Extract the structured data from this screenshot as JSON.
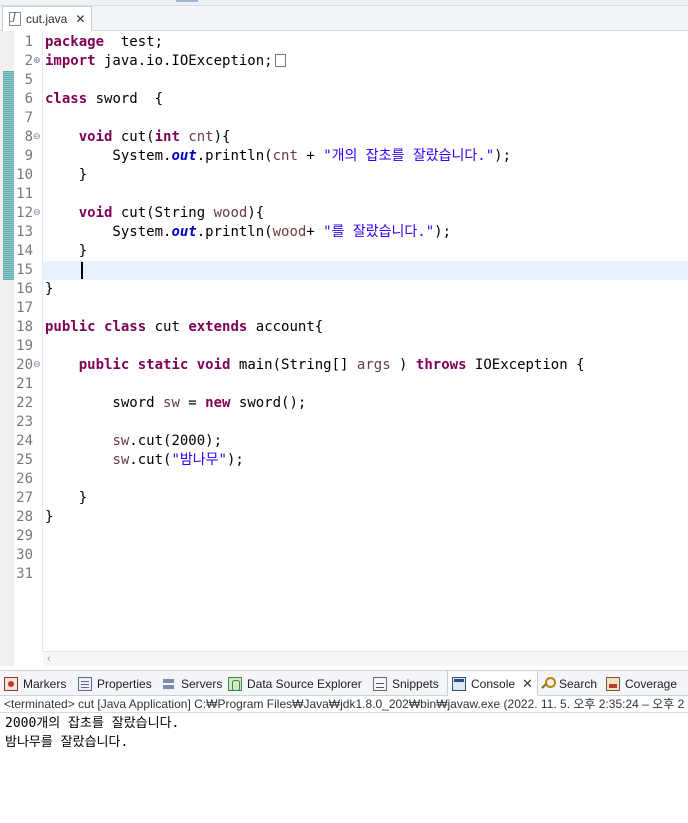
{
  "editor_tab": {
    "label": "cut.java",
    "close": "✕"
  },
  "code": [
    {
      "n": "1",
      "tokens": [
        [
          "kw",
          "package"
        ],
        [
          "",
          "  test;"
        ]
      ]
    },
    {
      "n": "2",
      "tokens": [
        [
          "kw",
          "import"
        ],
        [
          "",
          " java.io.IOException;"
        ]
      ],
      "fold": "⊕",
      "box": true
    },
    {
      "n": "5",
      "tokens": []
    },
    {
      "n": "6",
      "tokens": [
        [
          "kw",
          "class"
        ],
        [
          "",
          " sword  {"
        ]
      ]
    },
    {
      "n": "7",
      "tokens": []
    },
    {
      "n": "8",
      "tokens": [
        [
          "",
          "    "
        ],
        [
          "kw",
          "void"
        ],
        [
          "",
          " cut("
        ],
        [
          "kw",
          "int"
        ],
        [
          "",
          " "
        ],
        [
          "var",
          "cnt"
        ],
        [
          "",
          "){"
        ]
      ],
      "fold": "⊖"
    },
    {
      "n": "9",
      "tokens": [
        [
          "",
          "        System."
        ],
        [
          "fld",
          "out"
        ],
        [
          "",
          ".println("
        ],
        [
          "var",
          "cnt"
        ],
        [
          "",
          " + "
        ],
        [
          "str",
          "\"개의 잡초를 잘랐습니다.\""
        ],
        [
          "",
          ");"
        ]
      ]
    },
    {
      "n": "10",
      "tokens": [
        [
          "",
          "    }"
        ]
      ]
    },
    {
      "n": "11",
      "tokens": []
    },
    {
      "n": "12",
      "tokens": [
        [
          "",
          "    "
        ],
        [
          "kw",
          "void"
        ],
        [
          "",
          " cut(String "
        ],
        [
          "var",
          "wood"
        ],
        [
          "",
          "){"
        ]
      ],
      "fold": "⊖"
    },
    {
      "n": "13",
      "tokens": [
        [
          "",
          "        System."
        ],
        [
          "fld",
          "out"
        ],
        [
          "",
          ".println("
        ],
        [
          "var",
          "wood"
        ],
        [
          "",
          "+ "
        ],
        [
          "str",
          "\"를 잘랐습니다.\""
        ],
        [
          "",
          ");"
        ]
      ]
    },
    {
      "n": "14",
      "tokens": [
        [
          "",
          "    }"
        ]
      ]
    },
    {
      "n": "15",
      "tokens": [],
      "current": true
    },
    {
      "n": "16",
      "tokens": [
        [
          "",
          "}"
        ]
      ]
    },
    {
      "n": "17",
      "tokens": []
    },
    {
      "n": "18",
      "tokens": [
        [
          "kw",
          "public"
        ],
        [
          "",
          " "
        ],
        [
          "kw",
          "class"
        ],
        [
          "",
          " cut "
        ],
        [
          "kw",
          "extends"
        ],
        [
          "",
          " account{"
        ]
      ]
    },
    {
      "n": "19",
      "tokens": []
    },
    {
      "n": "20",
      "tokens": [
        [
          "",
          "    "
        ],
        [
          "kw",
          "public"
        ],
        [
          "",
          " "
        ],
        [
          "kw",
          "static"
        ],
        [
          "",
          " "
        ],
        [
          "kw",
          "void"
        ],
        [
          "",
          " main(String[] "
        ],
        [
          "var",
          "args"
        ],
        [
          "",
          " ) "
        ],
        [
          "kw",
          "throws"
        ],
        [
          "",
          " IOException {"
        ]
      ],
      "fold": "⊖"
    },
    {
      "n": "21",
      "tokens": []
    },
    {
      "n": "22",
      "tokens": [
        [
          "",
          "        sword "
        ],
        [
          "var",
          "sw"
        ],
        [
          "",
          " = "
        ],
        [
          "kw",
          "new"
        ],
        [
          "",
          " sword();"
        ]
      ]
    },
    {
      "n": "23",
      "tokens": []
    },
    {
      "n": "24",
      "tokens": [
        [
          "",
          "        "
        ],
        [
          "var",
          "sw"
        ],
        [
          "",
          ".cut(2000);"
        ]
      ]
    },
    {
      "n": "25",
      "tokens": [
        [
          "",
          "        "
        ],
        [
          "var",
          "sw"
        ],
        [
          "",
          ".cut("
        ],
        [
          "str",
          "\"밤나무\""
        ],
        [
          "",
          ");"
        ]
      ]
    },
    {
      "n": "26",
      "tokens": []
    },
    {
      "n": "27",
      "tokens": [
        [
          "",
          "    }"
        ]
      ]
    },
    {
      "n": "28",
      "tokens": [
        [
          "",
          "}"
        ]
      ]
    },
    {
      "n": "29",
      "tokens": []
    },
    {
      "n": "30",
      "tokens": []
    },
    {
      "n": "31",
      "tokens": []
    }
  ],
  "panel_tabs": [
    {
      "label": "Markers",
      "icon": "markers-icon",
      "cls": "ico-markers"
    },
    {
      "label": "Properties",
      "icon": "properties-icon",
      "cls": "ico-props"
    },
    {
      "label": "Servers",
      "icon": "servers-icon",
      "cls": "ico-servers"
    },
    {
      "label": "Data Source Explorer",
      "icon": "data-source-explorer-icon",
      "cls": "ico-dse"
    },
    {
      "label": "Snippets",
      "icon": "snippets-icon",
      "cls": "ico-snip"
    },
    {
      "label": "Console",
      "icon": "console-icon",
      "cls": "ico-console",
      "active": true,
      "close": "✕"
    },
    {
      "label": "Search",
      "icon": "search-icon",
      "cls": "ico-search"
    },
    {
      "label": "Coverage",
      "icon": "coverage-icon",
      "cls": "ico-cov"
    }
  ],
  "console": {
    "status": "<terminated> cut [Java Application] C:₩Program Files₩Java₩jdk1.8.0_202₩bin₩javaw.exe  (2022. 11. 5. 오후 2:35:24 – 오후 2",
    "output": [
      "2000개의 잡초를 잘랐습니다.",
      "밤나무를 잘랐습니다."
    ]
  }
}
